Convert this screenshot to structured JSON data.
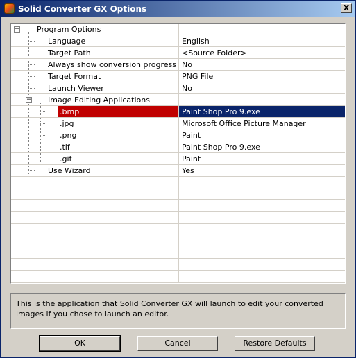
{
  "window": {
    "title": "Solid Converter GX Options",
    "close_label": "X"
  },
  "tree": {
    "root": {
      "label": "Program Options",
      "expander": "−"
    },
    "rows": [
      {
        "name": "Language",
        "value": "English"
      },
      {
        "name": "Target Path",
        "value": "<Source Folder>"
      },
      {
        "name": "Always show conversion progress",
        "value": "No"
      },
      {
        "name": "Target Format",
        "value": "PNG File"
      },
      {
        "name": "Launch Viewer",
        "value": "No"
      }
    ],
    "group": {
      "label": "Image Editing Applications",
      "expander": "−"
    },
    "apps": [
      {
        "name": ".bmp",
        "value": "Paint Shop Pro 9.exe",
        "selected": true
      },
      {
        "name": ".jpg",
        "value": "Microsoft Office Picture Manager"
      },
      {
        "name": ".png",
        "value": "Paint"
      },
      {
        "name": ".tif",
        "value": "Paint Shop Pro 9.exe"
      },
      {
        "name": ".gif",
        "value": "Paint"
      }
    ],
    "last": {
      "name": "Use Wizard",
      "value": "Yes"
    }
  },
  "description": "This is the application that Solid Converter GX will launch to edit your converted images if you chose to launch an editor.",
  "buttons": {
    "ok": "OK",
    "cancel": "Cancel",
    "restore": "Restore Defaults"
  },
  "colors": {
    "selection_name": "#c00000",
    "selection_value": "#0a246a",
    "title_start": "#0a246a",
    "title_end": "#a6caf0"
  }
}
